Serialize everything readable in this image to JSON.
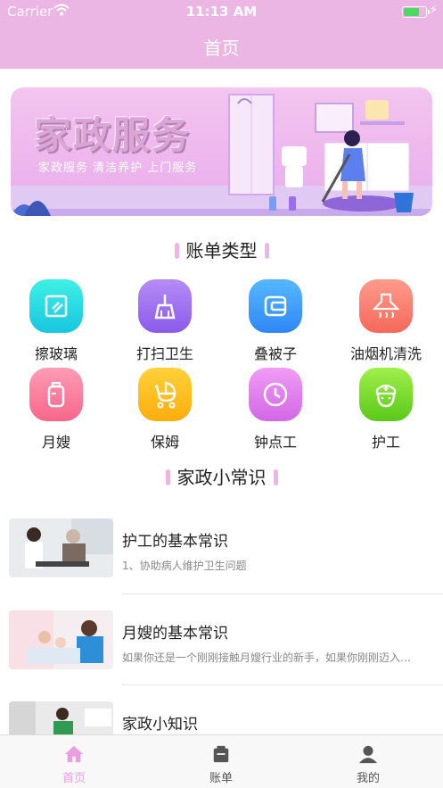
{
  "status_bar": {
    "carrier": "Carrier",
    "time": "11:13 AM",
    "battery_level": 0.75
  },
  "nav": {
    "title": "首页"
  },
  "banner": {
    "title": "家政服务",
    "subtitle": "家政服务 清洁养护 上门服务"
  },
  "bill_section": {
    "title": "账单类型",
    "items": [
      {
        "label": "擦玻璃",
        "icon": "glass-icon",
        "color_top": "#3ff0e4",
        "color_bottom": "#18c6df"
      },
      {
        "label": "打扫卫生",
        "icon": "broom-icon",
        "color_top": "#b58cf6",
        "color_bottom": "#8a5bea"
      },
      {
        "label": "叠被子",
        "icon": "quilt-icon",
        "color_top": "#55b8ff",
        "color_bottom": "#2f87f5"
      },
      {
        "label": "油烟机清洗",
        "icon": "range-hood-icon",
        "color_top": "#ff9b8a",
        "color_bottom": "#f5685a"
      },
      {
        "label": "月嫂",
        "icon": "baby-bottle-icon",
        "color_top": "#ff9cb3",
        "color_bottom": "#f6668b"
      },
      {
        "label": "保姆",
        "icon": "stroller-icon",
        "color_top": "#ffd13a",
        "color_bottom": "#ffad0d"
      },
      {
        "label": "钟点工",
        "icon": "clock-icon",
        "color_top": "#f09cf4",
        "color_bottom": "#d267e6"
      },
      {
        "label": "护工",
        "icon": "nurse-icon",
        "color_top": "#9ff04a",
        "color_bottom": "#5ac81a"
      }
    ]
  },
  "knowledge_section": {
    "title": "家政小常识",
    "articles": [
      {
        "title": "护工的基本常识",
        "summary": "1、协助病人维护卫生问题"
      },
      {
        "title": "月嫂的基本常识",
        "summary": "如果你还是一个刚刚接触月嫂行业的新手，如果你刚刚迈入月嫂行业"
      },
      {
        "title": "家政小知识",
        "summary": ""
      }
    ]
  },
  "tabbar": {
    "tabs": [
      {
        "label": "首页",
        "icon": "home-icon",
        "active": true
      },
      {
        "label": "账单",
        "icon": "bill-icon",
        "active": false
      },
      {
        "label": "我的",
        "icon": "profile-icon",
        "active": false
      }
    ]
  },
  "colors": {
    "accent": "#ebb6e3",
    "tab_active": "#ea9ee0",
    "tab_inactive": "#555555"
  }
}
